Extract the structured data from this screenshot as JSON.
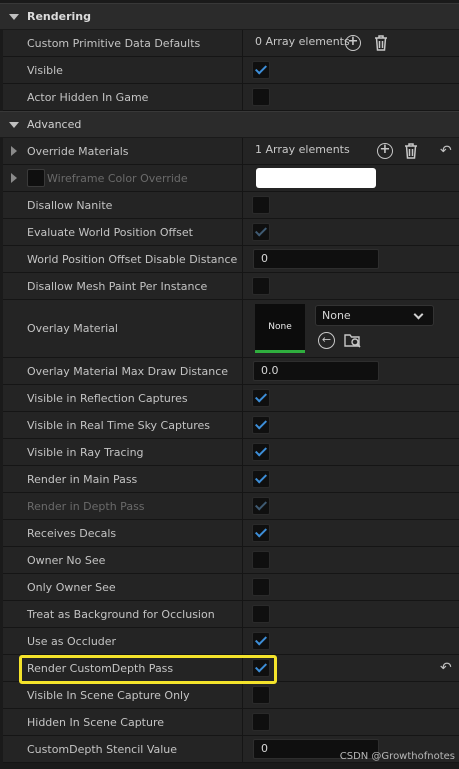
{
  "categories": {
    "rendering": "Rendering",
    "advanced": "Advanced"
  },
  "rendering_rows": [
    {
      "label": "Custom Primitive Data Defaults",
      "value": "0 Array elements"
    },
    {
      "label": "Visible",
      "checked": true
    },
    {
      "label": "Actor Hidden In Game",
      "checked": false
    }
  ],
  "advanced_rows": {
    "override_materials": {
      "label": "Override Materials",
      "value": "1 Array elements"
    },
    "wireframe": {
      "label": "Wireframe Color Override",
      "color": "#FFFFFF"
    },
    "disallow_nanite": {
      "label": "Disallow Nanite",
      "checked": false
    },
    "evaluate_wpo": {
      "label": "Evaluate World Position Offset",
      "checked": true
    },
    "wpo_disable_distance": {
      "label": "World Position Offset Disable Distance",
      "value": "0"
    },
    "disallow_mesh_paint": {
      "label": "Disallow Mesh Paint Per Instance",
      "checked": false
    },
    "overlay_material": {
      "label": "Overlay Material",
      "thumb_text": "None",
      "selected": "None"
    },
    "overlay_max_draw": {
      "label": "Overlay Material Max Draw Distance",
      "value": "0.0"
    },
    "vis_reflection": {
      "label": "Visible in Reflection Captures",
      "checked": true
    },
    "vis_realtime_sky": {
      "label": "Visible in Real Time Sky Captures",
      "checked": true
    },
    "vis_ray_tracing": {
      "label": "Visible in Ray Tracing",
      "checked": true
    },
    "render_main_pass": {
      "label": "Render in Main Pass",
      "checked": true
    },
    "render_depth_pass": {
      "label": "Render in Depth Pass",
      "checked": true
    },
    "receives_decals": {
      "label": "Receives Decals",
      "checked": true
    },
    "owner_no_see": {
      "label": "Owner No See",
      "checked": false
    },
    "only_owner_see": {
      "label": "Only Owner See",
      "checked": false
    },
    "treat_bg_occlusion": {
      "label": "Treat as Background for Occlusion",
      "checked": false
    },
    "use_as_occluder": {
      "label": "Use as Occluder",
      "checked": true
    },
    "render_custom_depth": {
      "label": "Render CustomDepth Pass",
      "checked": true
    },
    "vis_scene_capture_only": {
      "label": "Visible In Scene Capture Only",
      "checked": false
    },
    "hidden_scene_capture": {
      "label": "Hidden In Scene Capture",
      "checked": false
    },
    "custom_depth_stencil": {
      "label": "CustomDepth Stencil Value",
      "value": "0"
    }
  },
  "icons": {
    "add": "plus-circle-icon",
    "delete": "trash-icon",
    "reset": "reset-arrow-icon",
    "use_selected": "use-selected-icon",
    "browse": "browse-folder-icon"
  },
  "colors": {
    "highlight": "#F4E32B",
    "check": "#3D8ED8",
    "thumb_accent": "#2FAE3E"
  },
  "watermark": "CSDN @Growthofnotes"
}
